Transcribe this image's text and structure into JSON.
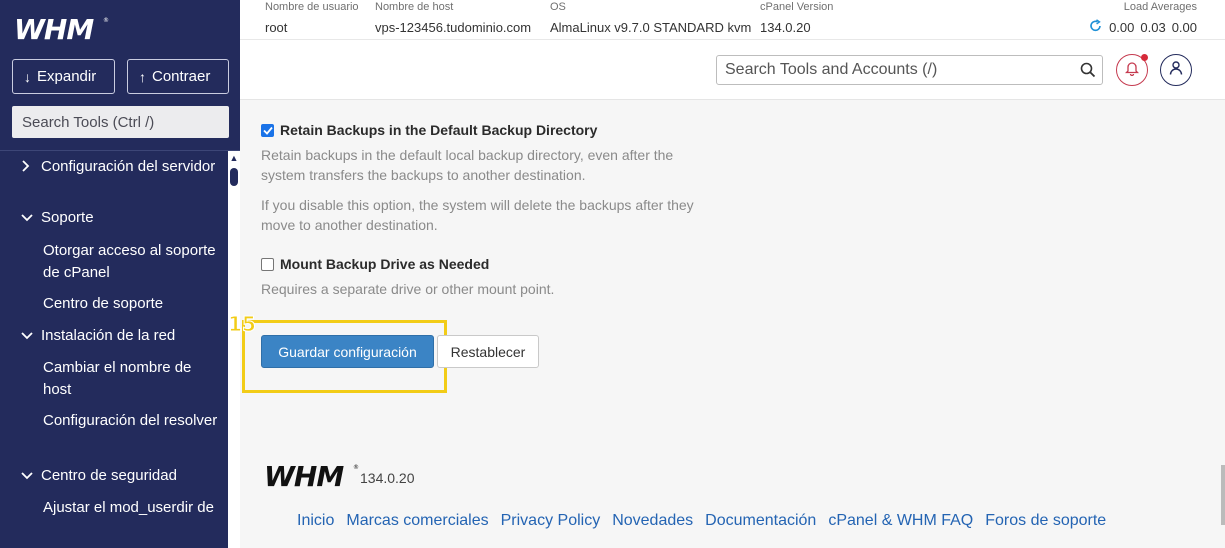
{
  "sidebar": {
    "expand_label": "Expandir",
    "collapse_label": "Contraer",
    "search_placeholder": "Search Tools (Ctrl /)",
    "categories": [
      {
        "label": "Configuración del servidor",
        "expanded": false
      },
      {
        "label": "Soporte",
        "expanded": true
      },
      {
        "label": "Instalación de la red",
        "expanded": true
      },
      {
        "label": "Centro de seguridad",
        "expanded": true
      }
    ],
    "subitems": {
      "soporte": [
        "Otorgar acceso al soporte de cPanel",
        "Centro de soporte"
      ],
      "red": [
        "Cambiar el nombre de host",
        "Configuración del resolver"
      ],
      "seguridad": [
        "Ajustar el mod_userdir de"
      ]
    }
  },
  "topbar": {
    "username_key": "Nombre de usuario",
    "username": "root",
    "hostname_key": "Nombre de host",
    "hostname": "vps-123456.tudominio.com",
    "os_key": "OS",
    "os": "AlmaLinux v9.7.0 STANDARD kvm",
    "cpanel_key": "cPanel Version",
    "cpanel": "134.0.20",
    "load_key": "Load Averages",
    "load": [
      "0.00",
      "0.03",
      "0.00"
    ]
  },
  "header": {
    "search_placeholder": "Search Tools and Accounts (/)"
  },
  "main": {
    "retain_label": "Retain Backups in the Default Backup Directory",
    "retain_checked": true,
    "retain_desc1": "Retain backups in the default local backup directory, even after the system transfers the backups to another destination.",
    "retain_desc2": "If you disable this option, the system will delete the backups after they move to another destination.",
    "mount_label": "Mount Backup Drive as Needed",
    "mount_checked": false,
    "mount_desc": "Requires a separate drive or other mount point.",
    "annotation_number": "15",
    "save_label": "Guardar configuración",
    "reset_label": "Restablecer"
  },
  "footer": {
    "version": "134.0.20",
    "links": [
      "Inicio",
      "Marcas comerciales",
      "Privacy Policy",
      "Novedades",
      "Documentación",
      "cPanel & WHM FAQ",
      "Foros de soporte"
    ]
  },
  "colors": {
    "sidebar_bg": "#232b5c",
    "primary_button": "#3b84c5",
    "annotation": "#f2cc17",
    "link": "#2464b3"
  }
}
